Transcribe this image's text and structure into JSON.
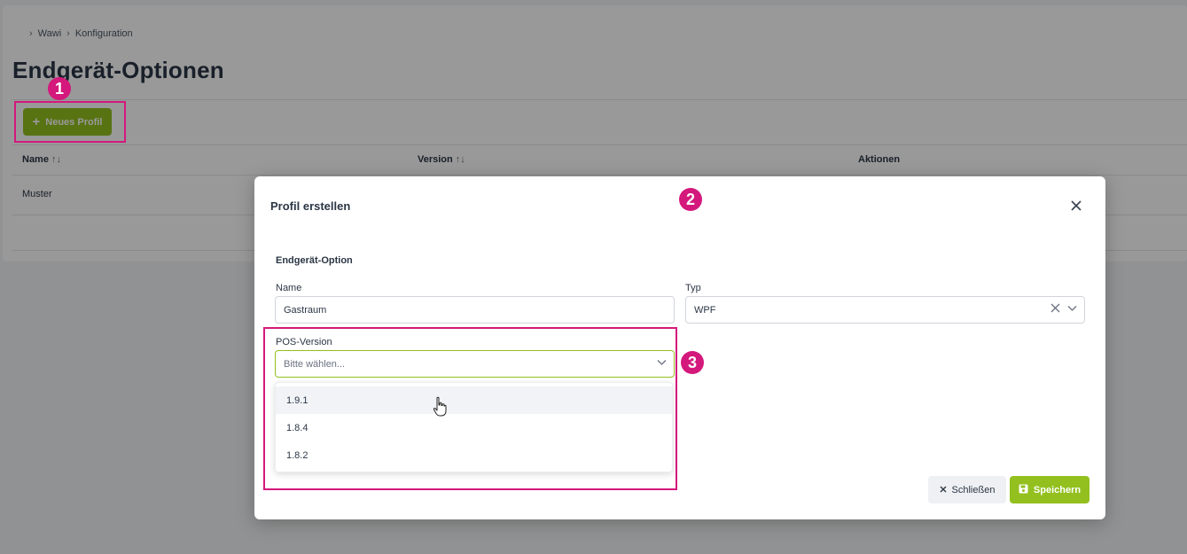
{
  "breadcrumb": [
    "Wawi",
    "Konfiguration"
  ],
  "page": {
    "title": "Endgerät-Optionen",
    "new_profile_button": "Neues Profil"
  },
  "table": {
    "columns": [
      {
        "label": "Name",
        "sortable": true
      },
      {
        "label": "Version",
        "sortable": true
      },
      {
        "label": "Aktionen",
        "sortable": false
      }
    ],
    "rows": [
      {
        "name": "Muster"
      }
    ],
    "sort_icon": "↑↓"
  },
  "modal": {
    "title": "Profil erstellen",
    "section": "Endgerät-Option",
    "name_label": "Name",
    "name_value": "Gastraum",
    "typ_label": "Typ",
    "typ_value": "WPF",
    "pos_label": "POS-Version",
    "pos_placeholder": "Bitte wählen...",
    "pos_options": [
      "1.9.1",
      "1.8.4",
      "1.8.2"
    ],
    "close_button": "Schließen",
    "save_button": "Speichern"
  },
  "annotations": [
    "1",
    "2",
    "3"
  ],
  "colors": {
    "accent_green": "#93c01f",
    "highlight_magenta": "#d4187c"
  },
  "icons": {
    "breadcrumb_separator": "chevron-right-icon",
    "new_profile": "plus-icon",
    "modal_close": "close-icon",
    "clear": "clear-icon",
    "select": "chevron-down-icon",
    "save": "floppy-disk-icon",
    "pointer": "hand-cursor-icon"
  }
}
